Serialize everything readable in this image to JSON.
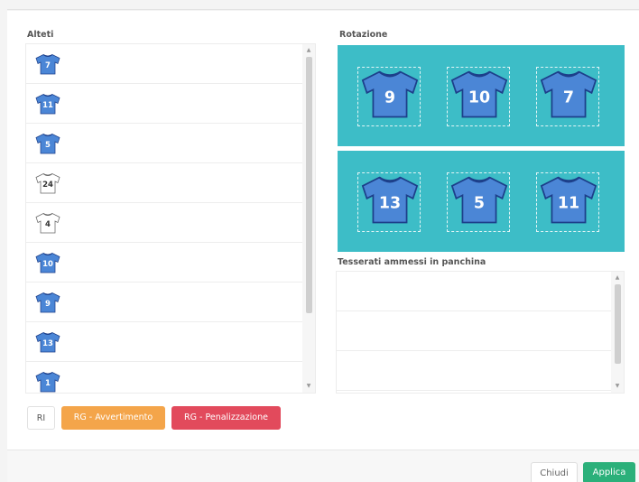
{
  "labels": {
    "athletes": "Alteti",
    "rotation": "Rotazione",
    "bench": "Tesserati ammessi in panchina"
  },
  "athletes": [
    {
      "number": "7",
      "style": "blue"
    },
    {
      "number": "11",
      "style": "blue"
    },
    {
      "number": "5",
      "style": "blue"
    },
    {
      "number": "24",
      "style": "white"
    },
    {
      "number": "4",
      "style": "white"
    },
    {
      "number": "10",
      "style": "blue"
    },
    {
      "number": "9",
      "style": "blue"
    },
    {
      "number": "13",
      "style": "blue"
    },
    {
      "number": "1",
      "style": "blue"
    }
  ],
  "rotation": {
    "front_row": [
      "9",
      "10",
      "7"
    ],
    "back_row": [
      "13",
      "5",
      "11"
    ]
  },
  "buttons": {
    "ri": "RI",
    "warning": "RG - Avvertimento",
    "penalty": "RG - Penalizzazione",
    "close": "Chiudi",
    "apply": "Applica"
  },
  "colors": {
    "court": "#3dbdc7",
    "jersey_blue": "#4b86d6",
    "warning": "#f4a54a",
    "penalty": "#e24a5c",
    "apply": "#2bb07a"
  },
  "icons": {
    "shirt": "shirt-icon",
    "scroll_up": "scroll-up-arrow",
    "scroll_down": "scroll-down-arrow"
  }
}
